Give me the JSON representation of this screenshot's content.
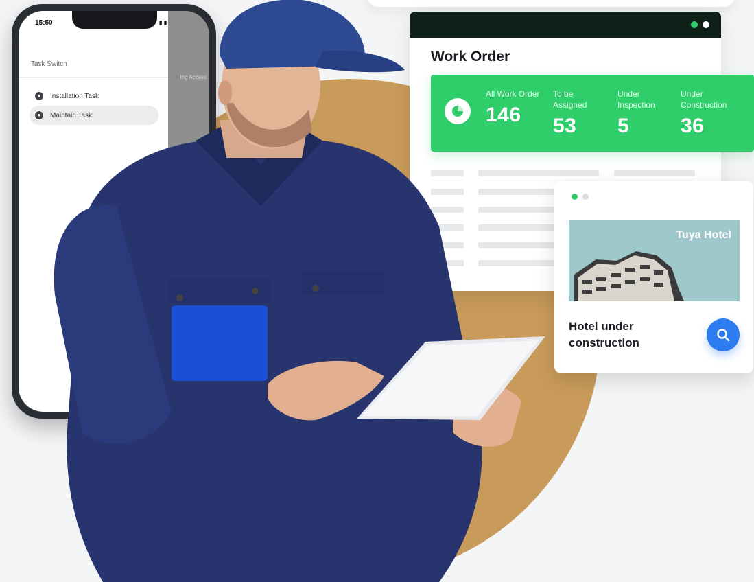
{
  "phone": {
    "time": "15:50",
    "header": "Task Switch",
    "side_text": "ing Access",
    "tasks": [
      {
        "label": "Installation Task",
        "selected": false
      },
      {
        "label": "Maintain Task",
        "selected": true
      }
    ]
  },
  "work_order": {
    "title": "Work Order",
    "stats": [
      {
        "label": "All Work Order",
        "value": "146"
      },
      {
        "label": "To be Assigned",
        "value": "53"
      },
      {
        "label": "Under Inspection",
        "value": "5"
      },
      {
        "label": "Under Construction",
        "value": "36"
      }
    ],
    "colors": {
      "accent": "#2fce6a",
      "topbar": "#0f2018"
    }
  },
  "hotel_card": {
    "image_title": "Tuya Hotel",
    "caption": "Hotel under construction",
    "search_icon": "search-icon",
    "colors": {
      "button": "#2d7cf0",
      "active_dot": "#2fce6a"
    }
  }
}
